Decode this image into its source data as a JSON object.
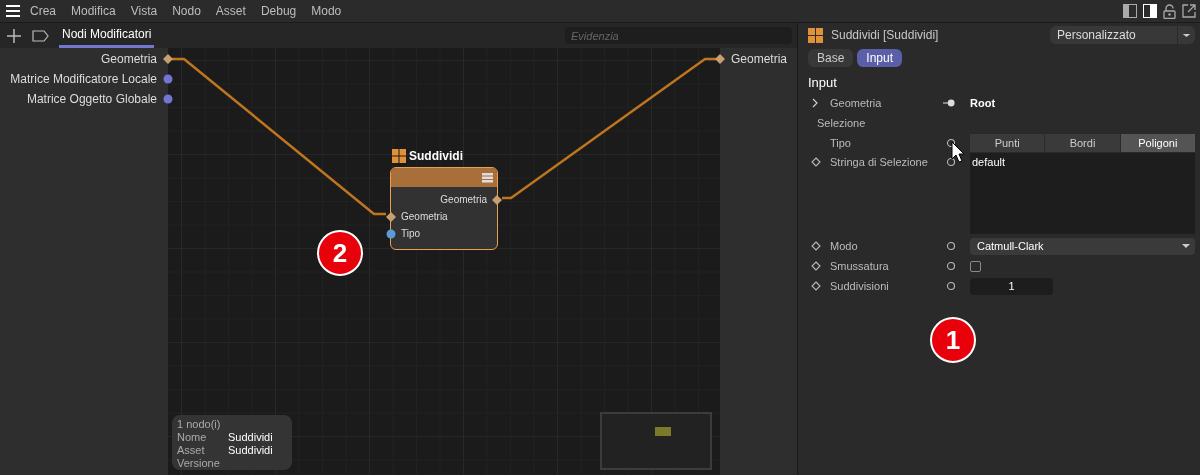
{
  "menu": {
    "items": [
      "Crea",
      "Modifica",
      "Vista",
      "Nodo",
      "Asset",
      "Debug",
      "Modo"
    ]
  },
  "toolbar": {
    "tabs": [
      {
        "label": "Nodi Modificatori",
        "selected": true
      }
    ],
    "search": {
      "placeholder": "Evidenzia"
    }
  },
  "graph": {
    "input_ports": [
      {
        "label": "Geometria",
        "kind": "geometry",
        "color": "#c8a070"
      },
      {
        "label": "Matrice Modificatore Locale",
        "kind": "matrix",
        "color": "#7474d4"
      },
      {
        "label": "Matrice Oggetto Globale",
        "kind": "matrix",
        "color": "#7474d4"
      }
    ],
    "output_ports": [
      {
        "label": "Geometria",
        "kind": "geometry",
        "color": "#c8a070"
      }
    ],
    "node": {
      "title": "Suddividi",
      "selected": true,
      "outputs": [
        {
          "label": "Geometria",
          "kind": "geometry",
          "color": "#c8a070"
        }
      ],
      "inputs": [
        {
          "label": "Geometria",
          "kind": "geometry",
          "color": "#c8a070"
        },
        {
          "label": "Tipo",
          "kind": "value",
          "color": "#5b9bd5"
        }
      ]
    },
    "badge": "2",
    "info": {
      "count": "1 nodo(i)",
      "fields": [
        {
          "label": "Nome",
          "value": "Suddividi"
        },
        {
          "label": "Asset",
          "value": "Suddividi"
        },
        {
          "label": "Versione"
        }
      ]
    }
  },
  "inspector": {
    "title": "Suddividi [Suddividi]",
    "preset": "Personalizzato",
    "tabs": [
      {
        "label": "Base",
        "selected": false
      },
      {
        "label": "Input",
        "selected": true
      }
    ],
    "section": "Input",
    "params": [
      {
        "kind": "link",
        "label": "Geometria",
        "value": "Root",
        "expanded": false
      },
      {
        "kind": "group",
        "label": "Selezione"
      },
      {
        "kind": "segmented",
        "label": "Tipo",
        "options": [
          {
            "label": "Punti",
            "selected": false
          },
          {
            "label": "Bordi",
            "selected": false
          },
          {
            "label": "Poligoni",
            "selected": true
          }
        ]
      },
      {
        "kind": "textarea",
        "label": "Stringa di Selezione",
        "value": "default"
      },
      {
        "kind": "dropdown",
        "label": "Modo",
        "value": "Catmull-Clark"
      },
      {
        "kind": "checkbox",
        "label": "Smussatura",
        "checked": false
      },
      {
        "kind": "number",
        "label": "Suddivisioni",
        "value": "1"
      }
    ],
    "badge": "1"
  }
}
